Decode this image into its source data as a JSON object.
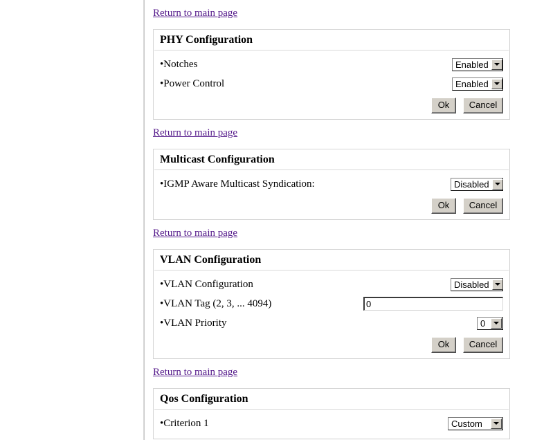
{
  "page": {
    "link_label": "Return to main page",
    "link_color": "#551a8b",
    "button_ok": "Ok",
    "button_cancel": "Cancel"
  },
  "sections": [
    {
      "id": "phy",
      "title": "PHY Configuration",
      "rows": [
        {
          "label": "Notches",
          "control": "select",
          "value": "Enabled"
        },
        {
          "label": "Power Control",
          "control": "select",
          "value": "Enabled"
        }
      ],
      "ok": "Ok",
      "cancel": "Cancel"
    },
    {
      "id": "multicast",
      "title": "Multicast Configuration",
      "rows": [
        {
          "label": "IGMP Aware Multicast Syndication:",
          "control": "select",
          "value": "Disabled"
        }
      ],
      "ok": "Ok",
      "cancel": "Cancel"
    },
    {
      "id": "vlan",
      "title": "VLAN Configuration",
      "rows": [
        {
          "label": "VLAN Configuration",
          "control": "select",
          "value": "Disabled"
        },
        {
          "label": "VLAN Tag (2, 3, ... 4094)",
          "control": "text",
          "value": "0"
        },
        {
          "label": "VLAN Priority",
          "control": "select",
          "value": "0"
        }
      ],
      "ok": "Ok",
      "cancel": "Cancel"
    },
    {
      "id": "qos",
      "title": "Qos Configuration",
      "rows": [
        {
          "label": "Criterion 1",
          "control": "select",
          "value": "Custom"
        }
      ]
    }
  ]
}
